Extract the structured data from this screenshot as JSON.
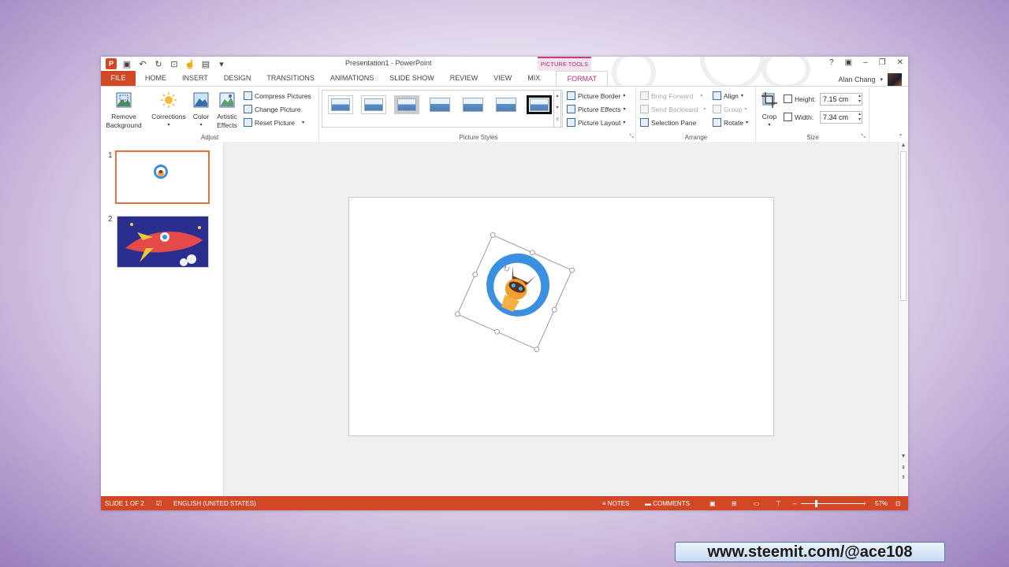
{
  "window": {
    "title": "Presentation1 - PowerPoint",
    "tools_label": "PICTURE TOOLS",
    "controls": [
      "?",
      "▣",
      "–",
      "❐",
      "✕"
    ]
  },
  "tabs": [
    "FILE",
    "HOME",
    "INSERT",
    "DESIGN",
    "TRANSITIONS",
    "ANIMATIONS",
    "SLIDE SHOW",
    "REVIEW",
    "VIEW",
    "MIX",
    "FORMAT"
  ],
  "user": {
    "name": "Alan Chang"
  },
  "ribbon": {
    "adjust": {
      "label": "Adjust",
      "remove_background": "Remove Background",
      "corrections": "Corrections",
      "color": "Color",
      "artistic_effects": "Artistic Effects",
      "compress_pictures": "Compress Pictures",
      "change_picture": "Change Picture",
      "reset_picture": "Reset Picture"
    },
    "picture_styles": {
      "label": "Picture Styles",
      "picture_border": "Picture Border",
      "picture_effects": "Picture Effects",
      "picture_layout": "Picture Layout"
    },
    "arrange": {
      "label": "Arrange",
      "bring_forward": "Bring Forward",
      "send_backward": "Send Backward",
      "selection_pane": "Selection Pane",
      "align": "Align",
      "group": "Group",
      "rotate": "Rotate"
    },
    "size": {
      "label": "Size",
      "crop": "Crop",
      "height_label": "Height:",
      "height_value": "7.15 cm",
      "width_label": "Width:",
      "width_value": "7.34 cm"
    }
  },
  "slides": [
    {
      "number": "1"
    },
    {
      "number": "2"
    }
  ],
  "status": {
    "slide_info": "SLIDE 1 OF 2",
    "language": "ENGLISH (UNITED STATES)",
    "notes": "NOTES",
    "comments": "COMMENTS",
    "zoom": "57%"
  },
  "watermark": "www.steemit.com/@ace108",
  "colors": {
    "accent": "#d24726",
    "format_tab": "#b03070"
  }
}
